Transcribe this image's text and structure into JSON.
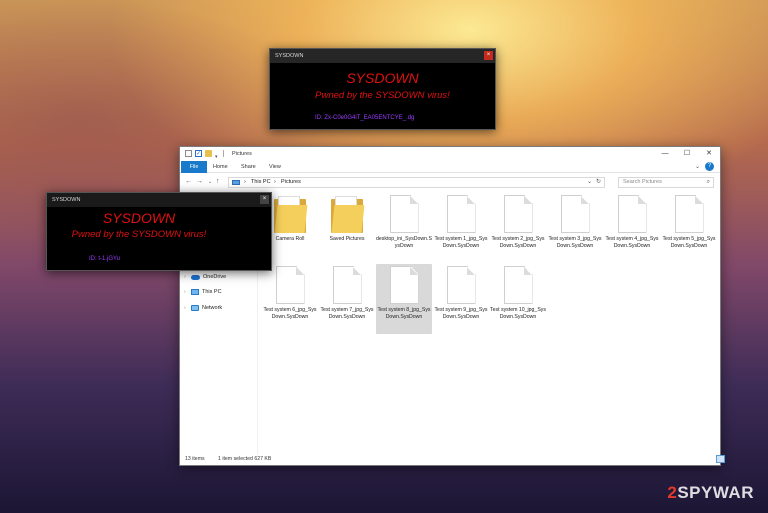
{
  "ransom_notes": [
    {
      "window_title": "SYSDOWN",
      "heading": "SYSDOWN",
      "message": "Pwned by the SYSDOWN virus!",
      "id_text": "ID:  Zx-C0e0G4iT_EA05ENTCYE_.dg"
    },
    {
      "window_title": "SYSDOWN",
      "heading": "SYSDOWN",
      "message": "Pwned by the SYSDOWN virus!",
      "id_text": "ID:  t-1.jGYu"
    }
  ],
  "explorer": {
    "title": "Pictures",
    "ribbon_tabs": [
      "File",
      "Home",
      "Share",
      "View"
    ],
    "address": {
      "root": "This PC",
      "current": "Pictures",
      "separator": "›"
    },
    "search_placeholder": "Search Pictures",
    "nav_items": [
      "OneDrive",
      "This PC",
      "Network"
    ],
    "items": [
      {
        "name": "Camera Roll",
        "type": "folder"
      },
      {
        "name": "Saved Pictures",
        "type": "folder"
      },
      {
        "name": "desktop_ini_SysDown.SysDown",
        "type": "file"
      },
      {
        "name": "Test system 1_jpg_SysDown.SysDown",
        "type": "file"
      },
      {
        "name": "Test system 2_jpg_SysDown.SysDown",
        "type": "file"
      },
      {
        "name": "Test system 3_jpg_SysDown.SysDown",
        "type": "file"
      },
      {
        "name": "Test system 4_jpg_SysDown.SysDown",
        "type": "file"
      },
      {
        "name": "Test system 5_jpg_SysDown.SysDown",
        "type": "file"
      },
      {
        "name": "Test system 6_jpg_SysDown.SysDown",
        "type": "file"
      },
      {
        "name": "Test system 7_jpg_SysDown.SysDown",
        "type": "file"
      },
      {
        "name": "Test system 8_jpg_SysDown.SysDown",
        "type": "file",
        "selected": true
      },
      {
        "name": "Test system 9_jpg_SysDown.SysDown",
        "type": "file"
      },
      {
        "name": "Test system 10_jpg_SysDown.SysDown",
        "type": "file"
      }
    ],
    "status": {
      "count": "13 items",
      "selected": "1 item selected  627 KB"
    }
  },
  "watermark": {
    "number": "2",
    "brand": "SPYWAR"
  },
  "colors": {
    "ransom_red": "#e01010",
    "ransom_id": "#9b3cff",
    "file_tab": "#1979ca"
  }
}
